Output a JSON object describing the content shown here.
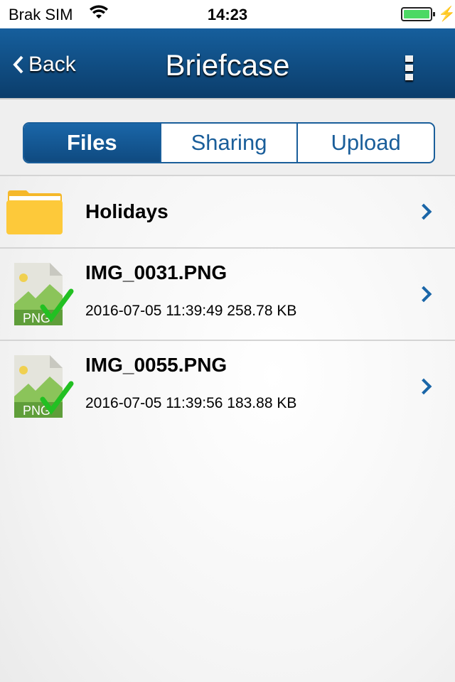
{
  "status": {
    "carrier": "Brak SIM",
    "time": "14:23",
    "battery_level": 1.0
  },
  "nav": {
    "back_label": "Back",
    "title": "Briefcase"
  },
  "tabs": [
    {
      "label": "Files",
      "selected": true
    },
    {
      "label": "Sharing",
      "selected": false
    },
    {
      "label": "Upload",
      "selected": false
    }
  ],
  "items": [
    {
      "type": "folder",
      "name": "Holidays"
    },
    {
      "type": "file",
      "name": "IMG_0031.PNG",
      "meta": "2016-07-05 11:39:49 258.78 KB",
      "badge": "PNG"
    },
    {
      "type": "file",
      "name": "IMG_0055.PNG",
      "meta": "2016-07-05 11:39:56 183.88 KB",
      "badge": "PNG"
    }
  ],
  "colors": {
    "accent": "#1a5e9a",
    "battery": "#4cd964",
    "check": "#22c022"
  }
}
